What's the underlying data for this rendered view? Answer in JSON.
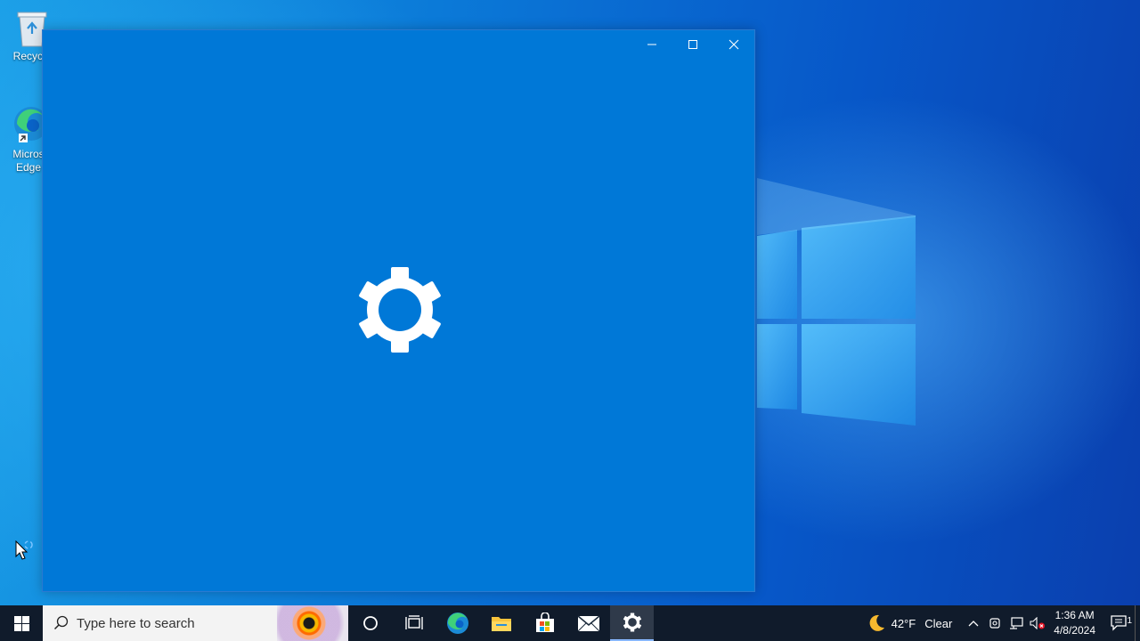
{
  "desktop": {
    "icons": [
      {
        "label": "Recycle Bin",
        "shown": "Recycle"
      },
      {
        "label": "Microsoft Edge",
        "line1": "Micros",
        "line2": "Edge"
      }
    ]
  },
  "settings_window": {
    "controls": {
      "minimize": "minimize-icon",
      "maximize": "maximize-icon",
      "close": "close-icon"
    },
    "splash_icon": "gear-icon",
    "colors": {
      "background": "#0078d7",
      "icon": "#ffffff"
    }
  },
  "taskbar": {
    "search": {
      "placeholder": "Type here to search"
    },
    "pinned_apps": [
      "cortana-circle",
      "task-view",
      "microsoft-edge",
      "file-explorer",
      "microsoft-store",
      "mail",
      "settings"
    ],
    "active_app": "settings",
    "weather": {
      "temp": "42°F",
      "condition": "Clear"
    },
    "clock": {
      "time": "1:36 AM",
      "date": "4/8/2024"
    },
    "notifications_count": "1"
  }
}
